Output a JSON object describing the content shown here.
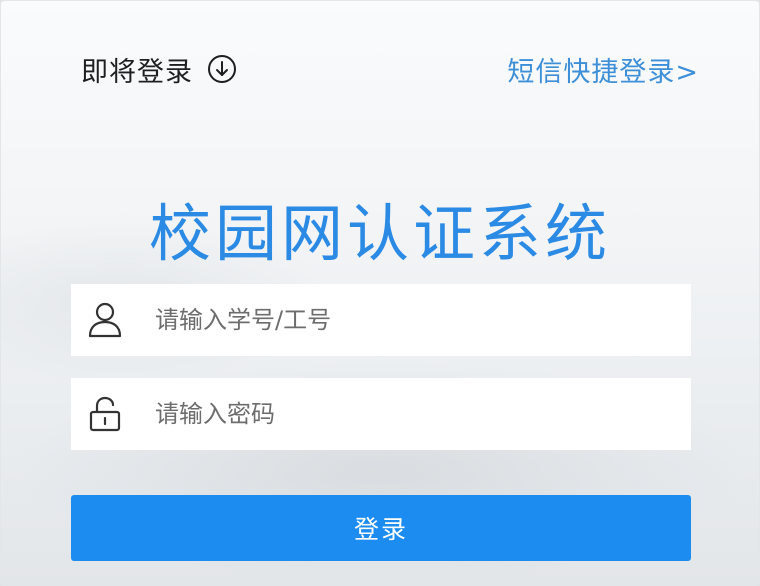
{
  "header": {
    "login_mode_label": "即将登录",
    "sms_login_link": "短信快捷登录>"
  },
  "title": "校园网认证系统",
  "form": {
    "username": {
      "placeholder": "请输入学号/工号",
      "value": "",
      "icon": "user-icon"
    },
    "password": {
      "placeholder": "请输入密码",
      "value": "",
      "icon": "lock-icon"
    },
    "submit_label": "登录"
  },
  "colors": {
    "accent": "#1c8cf0",
    "title": "#2b8ae4",
    "link": "#3d8fd8"
  }
}
